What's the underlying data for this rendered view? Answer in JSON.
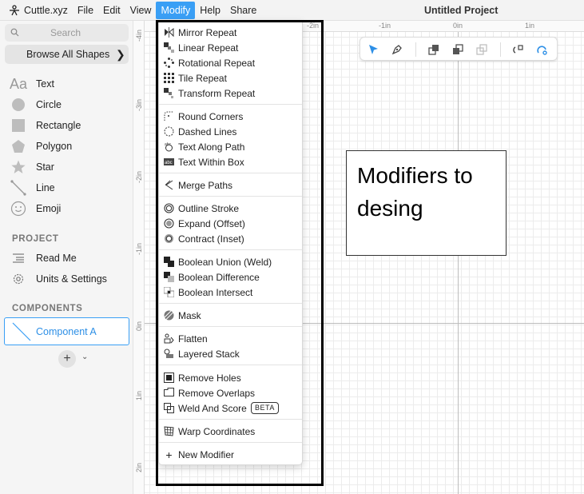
{
  "menubar": {
    "app_name": "Cuttle.xyz",
    "menus": [
      "File",
      "Edit",
      "View",
      "Modify",
      "Help",
      "Share"
    ],
    "active_menu": "Modify",
    "project_title": "Untitled Project"
  },
  "sidebar": {
    "search_placeholder": "Search",
    "browse_label": "Browse All Shapes",
    "tools": [
      {
        "label": "Text",
        "icon": "text-icon"
      },
      {
        "label": "Circle",
        "icon": "circle-icon"
      },
      {
        "label": "Rectangle",
        "icon": "rectangle-icon"
      },
      {
        "label": "Polygon",
        "icon": "polygon-icon"
      },
      {
        "label": "Star",
        "icon": "star-icon"
      },
      {
        "label": "Line",
        "icon": "line-icon"
      },
      {
        "label": "Emoji",
        "icon": "emoji-icon"
      }
    ],
    "project_heading": "PROJECT",
    "project_items": [
      {
        "label": "Read Me",
        "icon": "readme-icon"
      },
      {
        "label": "Units & Settings",
        "icon": "settings-icon"
      }
    ],
    "components_heading": "COMPONENTS",
    "component": {
      "label": "Component A"
    },
    "add_component": "+"
  },
  "rulers": {
    "top": [
      "-2in",
      "-1in",
      "0in",
      "1in"
    ],
    "left": [
      "-4in",
      "-3in",
      "-2in",
      "-1in",
      "0in",
      "1in",
      "2in"
    ]
  },
  "modify_menu": {
    "groups": [
      [
        {
          "label": "Mirror Repeat",
          "icon": "mirror-repeat-icon"
        },
        {
          "label": "Linear Repeat",
          "icon": "linear-repeat-icon"
        },
        {
          "label": "Rotational Repeat",
          "icon": "rotational-repeat-icon"
        },
        {
          "label": "Tile Repeat",
          "icon": "tile-repeat-icon"
        },
        {
          "label": "Transform Repeat",
          "icon": "transform-repeat-icon"
        }
      ],
      [
        {
          "label": "Round Corners",
          "icon": "round-corners-icon"
        },
        {
          "label": "Dashed Lines",
          "icon": "dashed-lines-icon"
        },
        {
          "label": "Text Along Path",
          "icon": "text-along-path-icon"
        },
        {
          "label": "Text Within Box",
          "icon": "text-within-box-icon"
        }
      ],
      [
        {
          "label": "Merge Paths",
          "icon": "merge-paths-icon"
        }
      ],
      [
        {
          "label": "Outline Stroke",
          "icon": "outline-stroke-icon"
        },
        {
          "label": "Expand (Offset)",
          "icon": "expand-offset-icon"
        },
        {
          "label": "Contract (Inset)",
          "icon": "contract-inset-icon"
        }
      ],
      [
        {
          "label": "Boolean Union (Weld)",
          "icon": "boolean-union-icon"
        },
        {
          "label": "Boolean Difference",
          "icon": "boolean-difference-icon"
        },
        {
          "label": "Boolean Intersect",
          "icon": "boolean-intersect-icon"
        }
      ],
      [
        {
          "label": "Mask",
          "icon": "mask-icon"
        }
      ],
      [
        {
          "label": "Flatten",
          "icon": "flatten-icon"
        },
        {
          "label": "Layered Stack",
          "icon": "layered-stack-icon"
        }
      ],
      [
        {
          "label": "Remove Holes",
          "icon": "remove-holes-icon"
        },
        {
          "label": "Remove Overlaps",
          "icon": "remove-overlaps-icon"
        },
        {
          "label": "Weld And Score",
          "icon": "weld-and-score-icon",
          "badge": "BETA"
        }
      ],
      [
        {
          "label": "Warp Coordinates",
          "icon": "warp-coordinates-icon"
        }
      ],
      [
        {
          "label": "New Modifier",
          "icon": "plus-icon"
        }
      ]
    ]
  },
  "annotation": {
    "text": "Modifiers to desing"
  },
  "colors": {
    "accent": "#3a9ff5",
    "annotation_border": "#000000"
  }
}
